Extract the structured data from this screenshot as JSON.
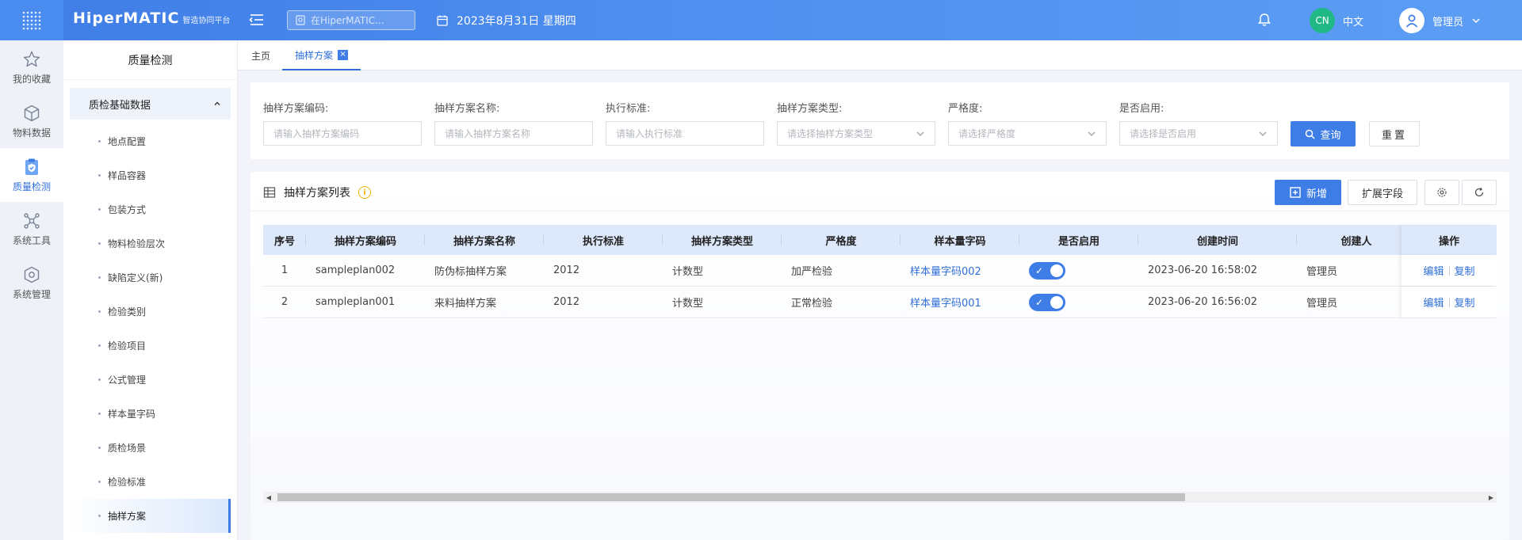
{
  "topbar": {
    "logo_main": "HiperMATIC",
    "logo_sub": "智造协同平台",
    "search_placeholder": "在HiperMATIC...",
    "date": "2023年8月31日 星期四",
    "lang_badge": "CN",
    "lang_label": "中文",
    "user_name": "管理员"
  },
  "rail": [
    {
      "label": "我的收藏",
      "icon": "star-icon"
    },
    {
      "label": "物料数据",
      "icon": "cube-icon"
    },
    {
      "label": "质量检测",
      "icon": "shield-clipboard-icon"
    },
    {
      "label": "系统工具",
      "icon": "molecule-icon"
    },
    {
      "label": "系统管理",
      "icon": "settings-hex-icon"
    }
  ],
  "sidebar": {
    "title": "质量检测",
    "group": "质检基础数据",
    "items": [
      "地点配置",
      "样品容器",
      "包装方式",
      "物料检验层次",
      "缺陷定义(新)",
      "检验类别",
      "检验项目",
      "公式管理",
      "样本量字码",
      "质检场景",
      "检验标准",
      "抽样方案"
    ]
  },
  "tabs": {
    "home": "主页",
    "current": "抽样方案"
  },
  "filters": [
    {
      "label": "抽样方案编码:",
      "placeholder": "请输入抽样方案编码"
    },
    {
      "label": "抽样方案名称:",
      "placeholder": "请输入抽样方案名称"
    },
    {
      "label": "执行标准:",
      "placeholder": "请输入执行标准"
    },
    {
      "label": "抽样方案类型:",
      "placeholder": "请选择抽样方案类型"
    },
    {
      "label": "严格度:",
      "placeholder": "请选择严格度"
    },
    {
      "label": "是否启用:",
      "placeholder": "请选择是否启用"
    }
  ],
  "buttons": {
    "query": "查询",
    "reset": "重置",
    "add": "新增",
    "extend": "扩展字段"
  },
  "panel": {
    "title": "抽样方案列表",
    "info": "i"
  },
  "table": {
    "headers": [
      "序号",
      "抽样方案编码",
      "抽样方案名称",
      "执行标准",
      "抽样方案类型",
      "严格度",
      "样本量字码",
      "是否启用",
      "创建时间",
      "创建人",
      "操作"
    ],
    "rows": [
      {
        "no": "1",
        "code": "sampleplan002",
        "name": "防伪标抽样方案",
        "standard": "2012",
        "type": "计数型",
        "strict": "加严检验",
        "letter": "样本量字码002",
        "enabled": true,
        "created": "2023-06-20 16:58:02",
        "creator": "管理员",
        "edit": "编辑",
        "copy": "复制"
      },
      {
        "no": "2",
        "code": "sampleplan001",
        "name": "来料抽样方案",
        "standard": "2012",
        "type": "计数型",
        "strict": "正常检验",
        "letter": "样本量字码001",
        "enabled": true,
        "created": "2023-06-20 16:56:02",
        "creator": "管理员",
        "edit": "编辑",
        "copy": "复制"
      }
    ]
  },
  "colors": {
    "primary": "#3f7de6",
    "success": "#20b986",
    "table_header": "#dde9fb"
  }
}
